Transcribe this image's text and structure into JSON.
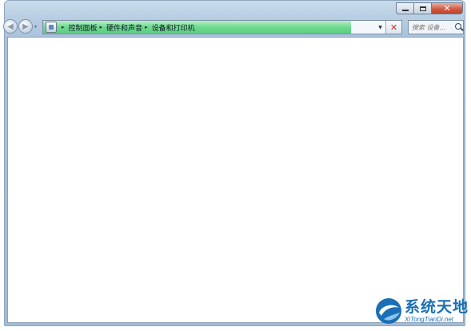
{
  "window": {
    "caption": {
      "minimize_symbol": "",
      "maximize_symbol": "",
      "close_symbol": "✕"
    }
  },
  "nav": {
    "back_glyph": "◀",
    "forward_glyph": "▶",
    "history_glyph": "▾"
  },
  "address_bar": {
    "icon": "control-panel-icon",
    "separator": "▸",
    "breadcrumbs": [
      "控制面板",
      "硬件和声音",
      "设备和打印机"
    ],
    "loading_progress_percent": 86,
    "dropdown_glyph": "▼",
    "stop_glyph": "✕",
    "progress_color": "#5fd283"
  },
  "search": {
    "placeholder": "搜索 设备..."
  },
  "watermark": {
    "name_cn": "系统天地",
    "domain": "XiTongTianDi.net"
  }
}
